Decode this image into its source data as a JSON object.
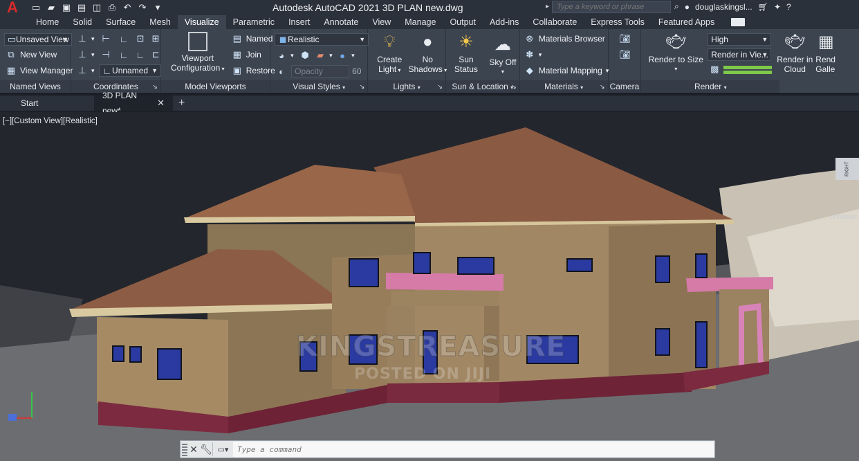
{
  "app": {
    "logo_letter": "A",
    "title": "Autodesk AutoCAD 2021    3D PLAN new.dwg",
    "search_placeholder": "Type a keyword or phrase",
    "user": "douglaskingsl...",
    "accent_red": "#d52b2b"
  },
  "ribbon_tabs": [
    "Home",
    "Solid",
    "Surface",
    "Mesh",
    "Visualize",
    "Parametric",
    "Insert",
    "Annotate",
    "View",
    "Manage",
    "Output",
    "Add-ins",
    "Collaborate",
    "Express Tools",
    "Featured Apps"
  ],
  "active_tab": "Visualize",
  "panels": {
    "named_views": {
      "title": "Named Views",
      "unsaved_view": "Unsaved View",
      "new_view": "New View",
      "view_manager": "View Manager"
    },
    "coordinates": {
      "title": "Coordinates",
      "ucs_name": "Unnamed"
    },
    "model_viewports": {
      "title": "Model Viewports",
      "viewport_config": "Viewport\nConfiguration",
      "viewport_config_line1": "Viewport",
      "viewport_config_line2": "Configuration",
      "named": "Named",
      "join": "Join",
      "restore": "Restore"
    },
    "visual_styles": {
      "title": "Visual Styles",
      "current_style": "Realistic",
      "opacity_label": "Opacity",
      "opacity_value": "60"
    },
    "lights": {
      "title": "Lights",
      "create_light_1": "Create",
      "create_light_2": "Light",
      "no_shadows_1": "No",
      "no_shadows_2": "Shadows"
    },
    "sun_location": {
      "title": "Sun & Location",
      "sun_status_1": "Sun",
      "sun_status_2": "Status",
      "sky_off_1": "Sky Off"
    },
    "materials": {
      "title": "Materials",
      "materials_browser": "Materials Browser",
      "material_mapping": "Material Mapping"
    },
    "camera": {
      "title": "Camera"
    },
    "render": {
      "title": "Render",
      "render_to_size": "Render to Size",
      "quality": "High",
      "render_in": "Render in Vie...",
      "render_cloud_1": "Render in",
      "render_cloud_2": "Cloud",
      "render_gallery_1": "Rend",
      "render_gallery_2": "Galle"
    }
  },
  "doc_tabs": [
    {
      "label": "Start",
      "active": false
    },
    {
      "label": "3D PLAN new*",
      "active": true
    }
  ],
  "viewport": {
    "label": "[−][Custom View][Realistic]",
    "viewcube_face": "RIGHT",
    "viewcube_caption": "Unnamed",
    "watermark_main": "KINGSTREASURE",
    "watermark_sub": "POSTED ON JIJI"
  },
  "command_line": {
    "placeholder": "Type a command"
  }
}
